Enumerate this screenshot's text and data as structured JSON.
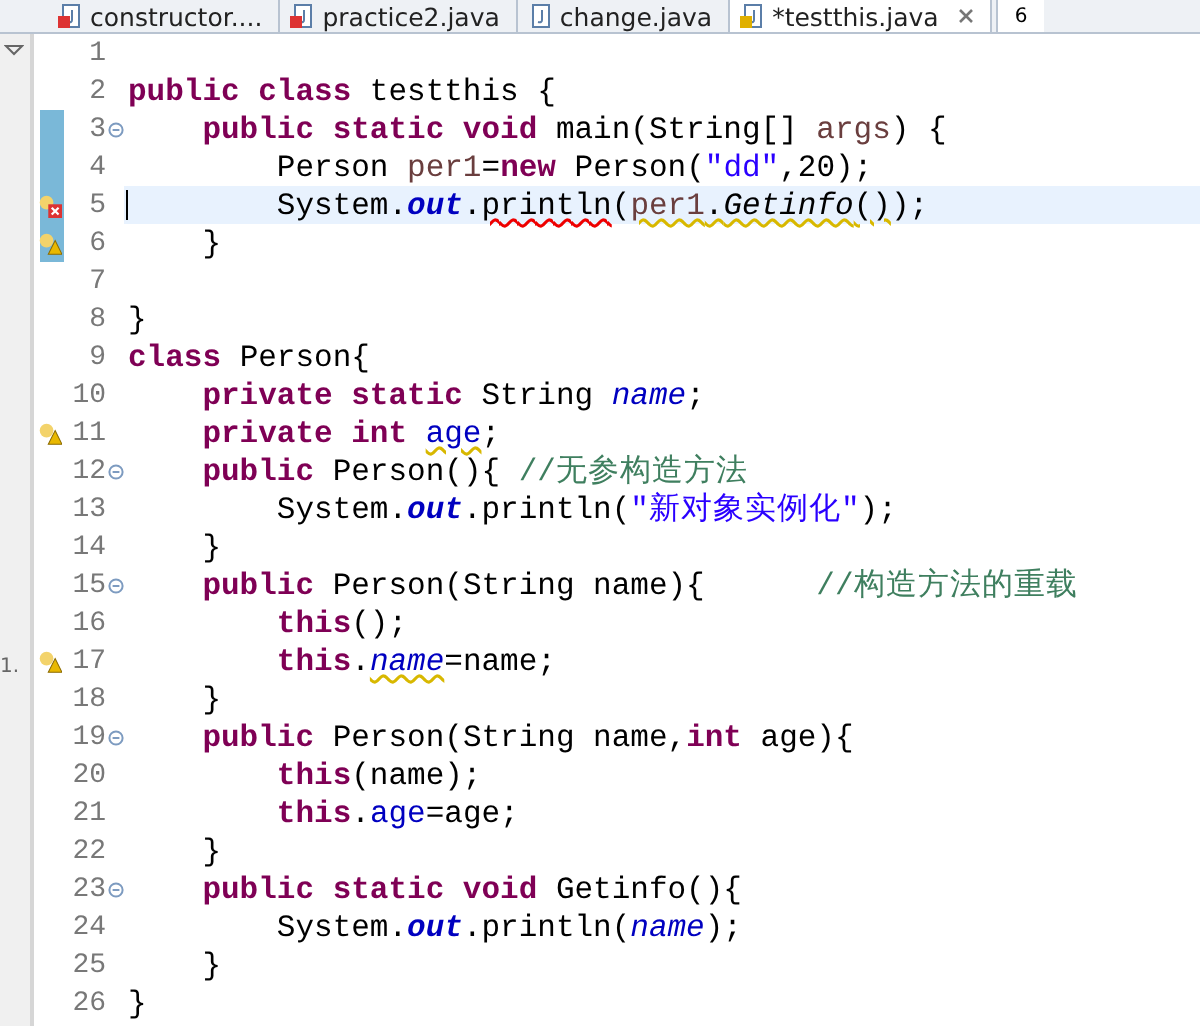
{
  "tabs": [
    {
      "label": "constructor....",
      "kind": "error",
      "selected": false,
      "closable": false
    },
    {
      "label": "practice2.java",
      "kind": "error",
      "selected": false,
      "closable": false
    },
    {
      "label": "change.java",
      "kind": "plain",
      "selected": false,
      "closable": false
    },
    {
      "label": "*testthis.java",
      "kind": "warning",
      "selected": true,
      "closable": true
    }
  ],
  "overflow_count": "6",
  "side_panel": {
    "label": "1."
  },
  "lines": [
    {
      "number": "1",
      "kind": "plain",
      "current": false,
      "changed": false,
      "fold": false
    },
    {
      "number": "2",
      "kind": "plain",
      "current": false,
      "changed": false,
      "fold": false,
      "tokens": [
        {
          "t": "public class ",
          "kind": "kw"
        },
        {
          "t": "testthis {",
          "kind": "txt"
        }
      ]
    },
    {
      "number": "3",
      "kind": "plain",
      "current": false,
      "changed": true,
      "fold": true,
      "tokens": [
        {
          "t": "    public static void ",
          "kind": "kw"
        },
        {
          "t": "main(String[] ",
          "kind": "txt"
        },
        {
          "t": "args",
          "kind": "var"
        },
        {
          "t": ") {",
          "kind": "txt"
        }
      ]
    },
    {
      "number": "4",
      "kind": "plain",
      "current": false,
      "changed": true,
      "fold": false,
      "tokens": [
        {
          "t": "        Person ",
          "kind": "txt"
        },
        {
          "t": "per1",
          "kind": "var"
        },
        {
          "t": "=",
          "kind": "txt"
        },
        {
          "t": "new ",
          "kind": "kw"
        },
        {
          "t": "Person(",
          "kind": "txt"
        },
        {
          "t": "\"dd\"",
          "kind": "str"
        },
        {
          "t": ",20);",
          "kind": "txt"
        }
      ]
    },
    {
      "number": "5",
      "kind": "error",
      "current": true,
      "changed": true,
      "fold": false,
      "tokens": [
        {
          "t": "        System.",
          "kind": "txt"
        },
        {
          "t": "out",
          "kind": "sfldb"
        },
        {
          "t": ".",
          "kind": "txt"
        },
        {
          "t": "println",
          "kind": "txt",
          "error_underline": true
        },
        {
          "t": "(",
          "kind": "txt"
        },
        {
          "t": "per1",
          "kind": "var",
          "warning_underline": true
        },
        {
          "t": ".",
          "kind": "txt",
          "warning_underline": true
        },
        {
          "t": "Getinfo",
          "kind": "smeth",
          "warning_underline": true
        },
        {
          "t": "()",
          "kind": "txt",
          "warning_underline": true
        },
        {
          "t": ");",
          "kind": "txt"
        }
      ]
    },
    {
      "number": "6",
      "kind": "warning",
      "current": false,
      "changed": true,
      "fold": false,
      "tokens": [
        {
          "t": "    }",
          "kind": "txt"
        }
      ]
    },
    {
      "number": "7",
      "kind": "plain",
      "current": false,
      "changed": false,
      "fold": false
    },
    {
      "number": "8",
      "kind": "plain",
      "current": false,
      "changed": false,
      "fold": false,
      "tokens": [
        {
          "t": "}",
          "kind": "txt"
        }
      ]
    },
    {
      "number": "9",
      "kind": "plain",
      "current": false,
      "changed": false,
      "fold": false,
      "tokens": [
        {
          "t": "class ",
          "kind": "kw"
        },
        {
          "t": "Person{",
          "kind": "txt"
        }
      ]
    },
    {
      "number": "10",
      "kind": "plain",
      "current": false,
      "changed": false,
      "fold": false,
      "tokens": [
        {
          "t": "    private static ",
          "kind": "kw"
        },
        {
          "t": "String ",
          "kind": "txt"
        },
        {
          "t": "name",
          "kind": "sfld"
        },
        {
          "t": ";",
          "kind": "txt"
        }
      ]
    },
    {
      "number": "11",
      "kind": "warning",
      "current": false,
      "changed": false,
      "fold": false,
      "tokens": [
        {
          "t": "    private int ",
          "kind": "kw"
        },
        {
          "t": "age",
          "kind": "fld",
          "warning_underline": true
        },
        {
          "t": ";",
          "kind": "txt"
        }
      ]
    },
    {
      "number": "12",
      "kind": "plain",
      "current": false,
      "changed": false,
      "fold": true,
      "tokens": [
        {
          "t": "    public ",
          "kind": "kw"
        },
        {
          "t": "Person(){ ",
          "kind": "txt"
        },
        {
          "t": "//无参构造方法",
          "kind": "cmt"
        }
      ]
    },
    {
      "number": "13",
      "kind": "plain",
      "current": false,
      "changed": false,
      "fold": false,
      "tokens": [
        {
          "t": "        System.",
          "kind": "txt"
        },
        {
          "t": "out",
          "kind": "sfldb"
        },
        {
          "t": ".println(",
          "kind": "txt"
        },
        {
          "t": "\"新对象实例化\"",
          "kind": "str"
        },
        {
          "t": ");",
          "kind": "txt"
        }
      ]
    },
    {
      "number": "14",
      "kind": "plain",
      "current": false,
      "changed": false,
      "fold": false,
      "tokens": [
        {
          "t": "    }",
          "kind": "txt"
        }
      ]
    },
    {
      "number": "15",
      "kind": "plain",
      "current": false,
      "changed": false,
      "fold": true,
      "tokens": [
        {
          "t": "    public ",
          "kind": "kw"
        },
        {
          "t": "Person(String name){      ",
          "kind": "txt"
        },
        {
          "t": "//构造方法的重载",
          "kind": "cmt"
        }
      ]
    },
    {
      "number": "16",
      "kind": "plain",
      "current": false,
      "changed": false,
      "fold": false,
      "tokens": [
        {
          "t": "        this",
          "kind": "kw"
        },
        {
          "t": "();",
          "kind": "txt"
        }
      ]
    },
    {
      "number": "17",
      "kind": "warning",
      "current": false,
      "changed": false,
      "fold": false,
      "tokens": [
        {
          "t": "        this",
          "kind": "kw"
        },
        {
          "t": ".",
          "kind": "txt"
        },
        {
          "t": "name",
          "kind": "sfld",
          "warning_underline": true
        },
        {
          "t": "=name;",
          "kind": "txt"
        }
      ]
    },
    {
      "number": "18",
      "kind": "plain",
      "current": false,
      "changed": false,
      "fold": false,
      "tokens": [
        {
          "t": "    }",
          "kind": "txt"
        }
      ]
    },
    {
      "number": "19",
      "kind": "plain",
      "current": false,
      "changed": false,
      "fold": true,
      "tokens": [
        {
          "t": "    public ",
          "kind": "kw"
        },
        {
          "t": "Person(String name,",
          "kind": "txt"
        },
        {
          "t": "int ",
          "kind": "kw"
        },
        {
          "t": "age){",
          "kind": "txt"
        }
      ]
    },
    {
      "number": "20",
      "kind": "plain",
      "current": false,
      "changed": false,
      "fold": false,
      "tokens": [
        {
          "t": "        this",
          "kind": "kw"
        },
        {
          "t": "(name);",
          "kind": "txt"
        }
      ]
    },
    {
      "number": "21",
      "kind": "plain",
      "current": false,
      "changed": false,
      "fold": false,
      "tokens": [
        {
          "t": "        this",
          "kind": "kw"
        },
        {
          "t": ".",
          "kind": "txt"
        },
        {
          "t": "age",
          "kind": "fld"
        },
        {
          "t": "=age;",
          "kind": "txt"
        }
      ]
    },
    {
      "number": "22",
      "kind": "plain",
      "current": false,
      "changed": false,
      "fold": false,
      "tokens": [
        {
          "t": "    }",
          "kind": "txt"
        }
      ]
    },
    {
      "number": "23",
      "kind": "plain",
      "current": false,
      "changed": false,
      "fold": true,
      "tokens": [
        {
          "t": "    public static void ",
          "kind": "kw"
        },
        {
          "t": "Getinfo(){",
          "kind": "txt"
        }
      ]
    },
    {
      "number": "24",
      "kind": "plain",
      "current": false,
      "changed": false,
      "fold": false,
      "tokens": [
        {
          "t": "        System.",
          "kind": "txt"
        },
        {
          "t": "out",
          "kind": "sfldb"
        },
        {
          "t": ".println(",
          "kind": "txt"
        },
        {
          "t": "name",
          "kind": "sfld"
        },
        {
          "t": ");",
          "kind": "txt"
        }
      ]
    },
    {
      "number": "25",
      "kind": "plain",
      "current": false,
      "changed": false,
      "fold": false,
      "tokens": [
        {
          "t": "    }",
          "kind": "txt"
        }
      ]
    },
    {
      "number": "26",
      "kind": "plain",
      "current": false,
      "changed": false,
      "fold": false,
      "tokens": [
        {
          "t": "}",
          "kind": "txt"
        }
      ]
    }
  ]
}
